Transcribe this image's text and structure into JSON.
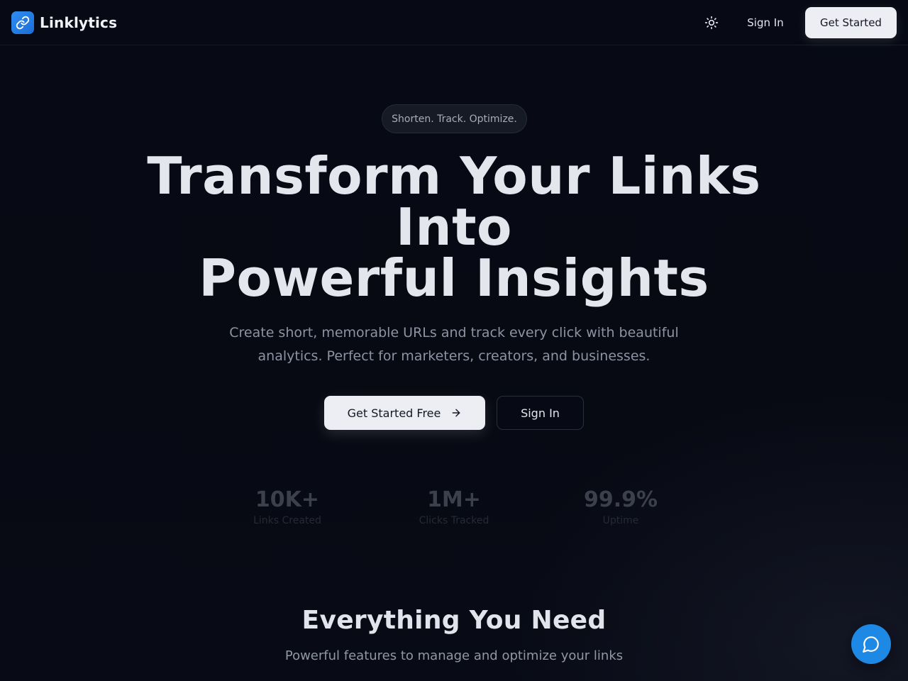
{
  "header": {
    "brand_name": "Linklytics",
    "sign_in_label": "Sign In",
    "get_started_label": "Get Started",
    "theme_toggle_icon": "sun-icon",
    "logo_icon": "link-icon"
  },
  "hero": {
    "tagline": "Shorten. Track. Optimize.",
    "title_line1": "Transform Your Links",
    "title_line2": "Into",
    "title_line3": "Powerful Insights",
    "subtitle": "Create short, memorable URLs and track every click with beautiful analytics. Perfect for marketers, creators, and businesses.",
    "cta_primary_label": "Get Started Free",
    "cta_primary_icon": "arrow-right-icon",
    "cta_secondary_label": "Sign In"
  },
  "stats": [
    {
      "value": "10K+",
      "label": "Links Created"
    },
    {
      "value": "1M+",
      "label": "Clicks Tracked"
    },
    {
      "value": "99.9%",
      "label": "Uptime"
    }
  ],
  "features": {
    "title": "Everything You Need",
    "subtitle": "Powerful features to manage and optimize your links"
  },
  "chat": {
    "icon": "chat-bubble-icon"
  },
  "colors": {
    "background": "#070a14",
    "accent": "#1e88e5",
    "button_light": "#eceef3"
  }
}
